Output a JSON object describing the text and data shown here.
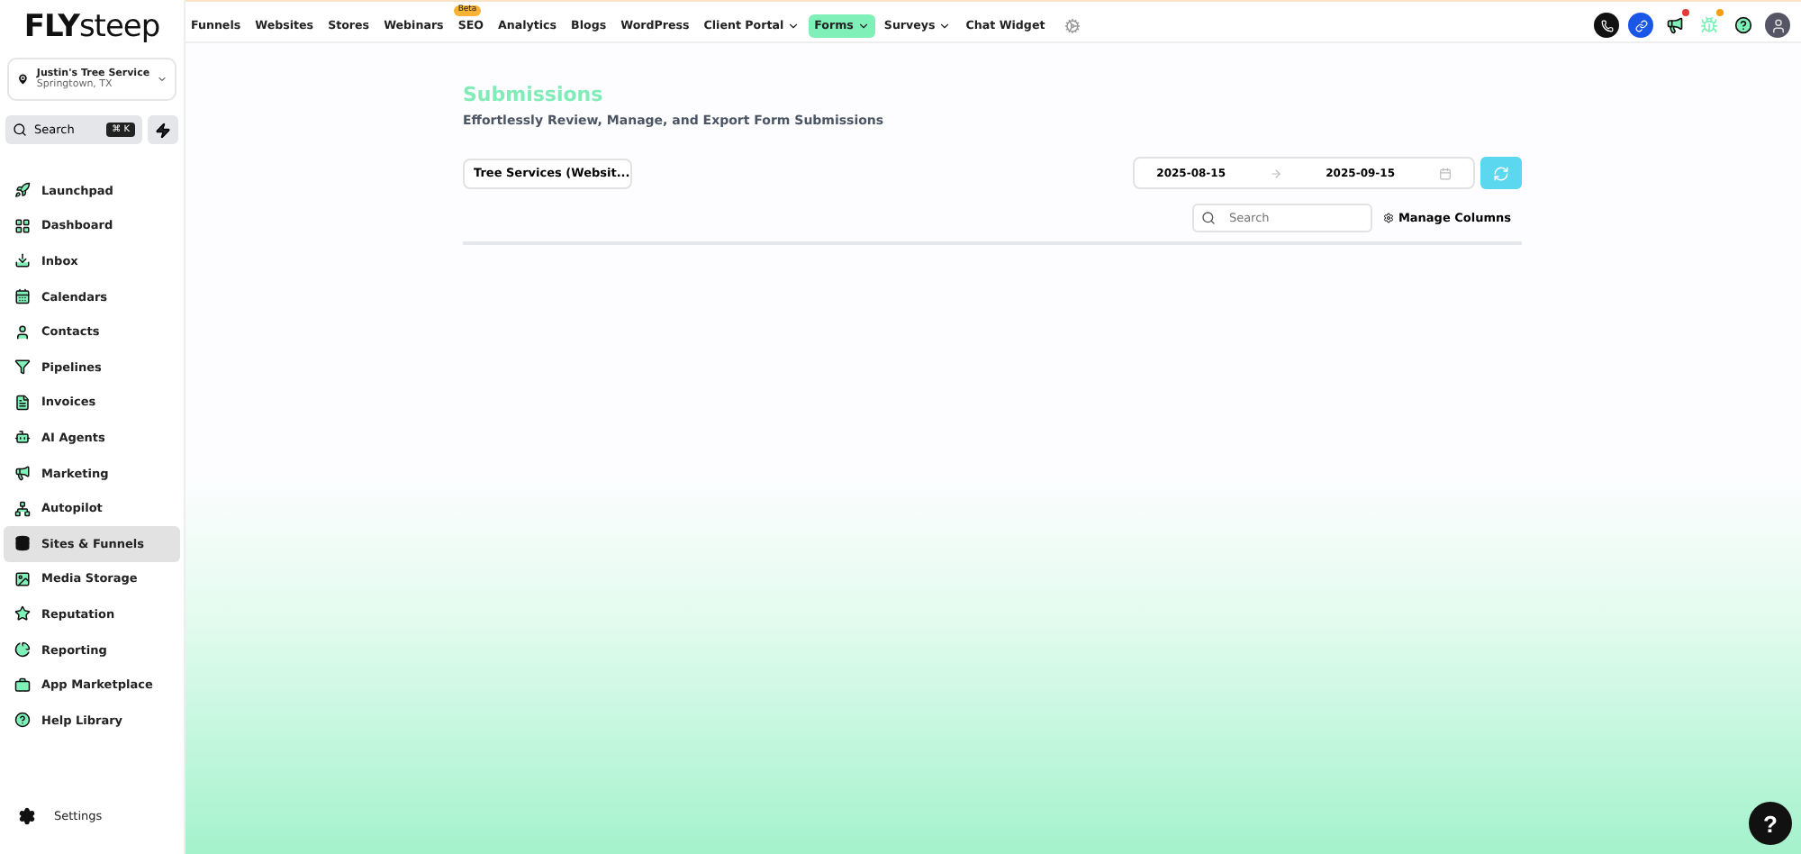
{
  "brand": {
    "logo_bold": "FLY",
    "logo_light": "steep"
  },
  "location": {
    "name": "Justin's Tree Service",
    "place": "Springtown, TX"
  },
  "search": {
    "label": "Search",
    "shortcut": "⌘ K"
  },
  "sidebar": {
    "items": [
      {
        "label": "Launchpad",
        "selected": false
      },
      {
        "label": "Dashboard",
        "selected": false
      },
      {
        "label": "Inbox",
        "selected": false
      },
      {
        "label": "Calendars",
        "selected": false
      },
      {
        "label": "Contacts",
        "selected": false
      },
      {
        "label": "Pipelines",
        "selected": false
      },
      {
        "label": "Invoices",
        "selected": false
      },
      {
        "label": "AI Agents",
        "selected": false
      },
      {
        "label": "Marketing",
        "selected": false
      },
      {
        "label": "Autopilot",
        "selected": false
      },
      {
        "label": "Sites & Funnels",
        "selected": true
      },
      {
        "label": "Media Storage",
        "selected": false
      },
      {
        "label": "Reputation",
        "selected": false
      },
      {
        "label": "Reporting",
        "selected": false
      },
      {
        "label": "App Marketplace",
        "selected": false
      },
      {
        "label": "Help Library",
        "selected": false
      }
    ],
    "settings": "Settings"
  },
  "nav": [
    {
      "label": "Funnels",
      "selected": false,
      "dropdown": false
    },
    {
      "label": "Websites",
      "selected": false,
      "dropdown": false
    },
    {
      "label": "Stores",
      "selected": false,
      "dropdown": false
    },
    {
      "label": "Webinars",
      "selected": false,
      "dropdown": false
    },
    {
      "label": "SEO",
      "selected": false,
      "dropdown": false,
      "badge": "Beta"
    },
    {
      "label": "Analytics",
      "selected": false,
      "dropdown": false
    },
    {
      "label": "Blogs",
      "selected": false,
      "dropdown": false
    },
    {
      "label": "WordPress",
      "selected": false,
      "dropdown": false
    },
    {
      "label": "Client Portal",
      "selected": false,
      "dropdown": true
    },
    {
      "label": "Forms",
      "selected": true,
      "dropdown": true
    },
    {
      "label": "Surveys",
      "selected": false,
      "dropdown": true
    },
    {
      "label": "Chat Widget",
      "selected": false,
      "dropdown": false
    }
  ],
  "page": {
    "title": "Submissions",
    "subtitle": "Effortlessly Review, Manage, and Export Form Submissions",
    "form_select": "Tree Services (Websit...",
    "date_from": "2025-08-15",
    "date_to": "2025-09-15",
    "search_placeholder": "Search",
    "manage_columns": "Manage Columns"
  },
  "help_button": "?"
}
